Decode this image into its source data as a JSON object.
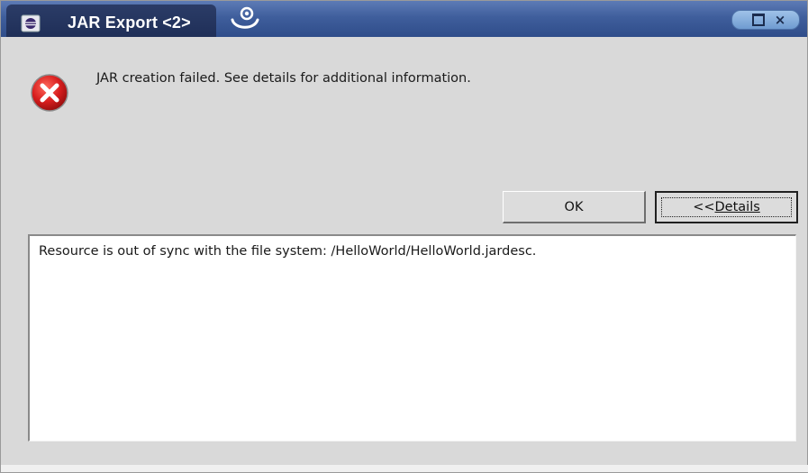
{
  "window": {
    "title": "JAR Export <2>",
    "controls": {
      "maximize": "□",
      "close": "×"
    }
  },
  "dialog": {
    "icon": "error-icon",
    "message": "JAR creation failed. See details for additional information."
  },
  "buttons": {
    "ok_label": "OK",
    "details_prefix": "<<",
    "details_label": "Details"
  },
  "details": {
    "text": "Resource is out of sync with the file system: /HelloWorld/HelloWorld.jardesc."
  },
  "colors": {
    "titlebar": "#3f5e9c",
    "title_tab": "#1f2f58",
    "error_red": "#d81e1e",
    "dialog_bg": "#d9d9d9"
  }
}
